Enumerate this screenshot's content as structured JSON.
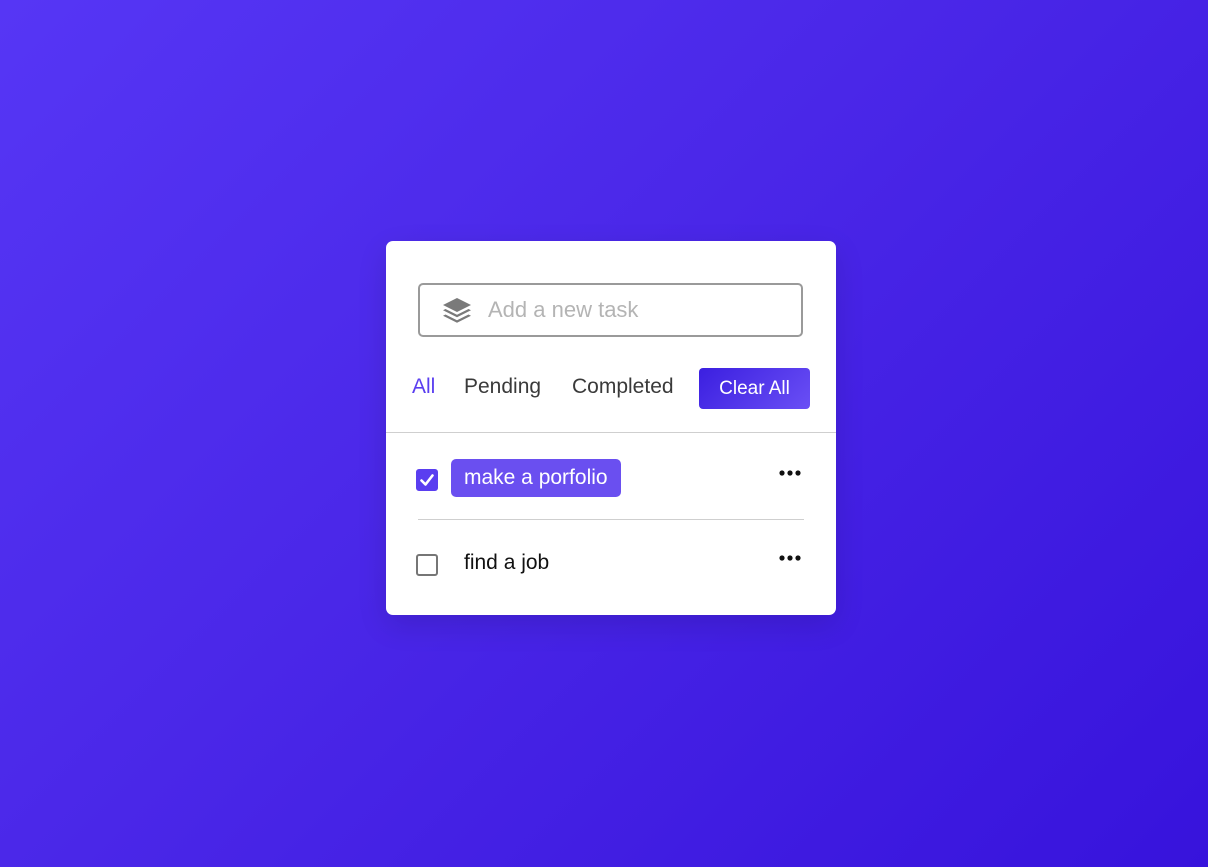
{
  "input": {
    "placeholder": "Add a new task",
    "value": ""
  },
  "filters": [
    {
      "label": "All",
      "active": true
    },
    {
      "label": "Pending",
      "active": false
    },
    {
      "label": "Completed",
      "active": false
    }
  ],
  "clear_all_label": "Clear All",
  "tasks": [
    {
      "text": "make a porfolio",
      "completed": true
    },
    {
      "text": "find a job",
      "completed": false
    }
  ],
  "colors": {
    "accent": "#5a3ef0",
    "background_start": "#5636f5",
    "background_end": "#3713dc"
  },
  "icons": {
    "input_icon": "layers-icon",
    "task_menu": "more-horizontal-icon",
    "check": "checkmark-icon"
  }
}
